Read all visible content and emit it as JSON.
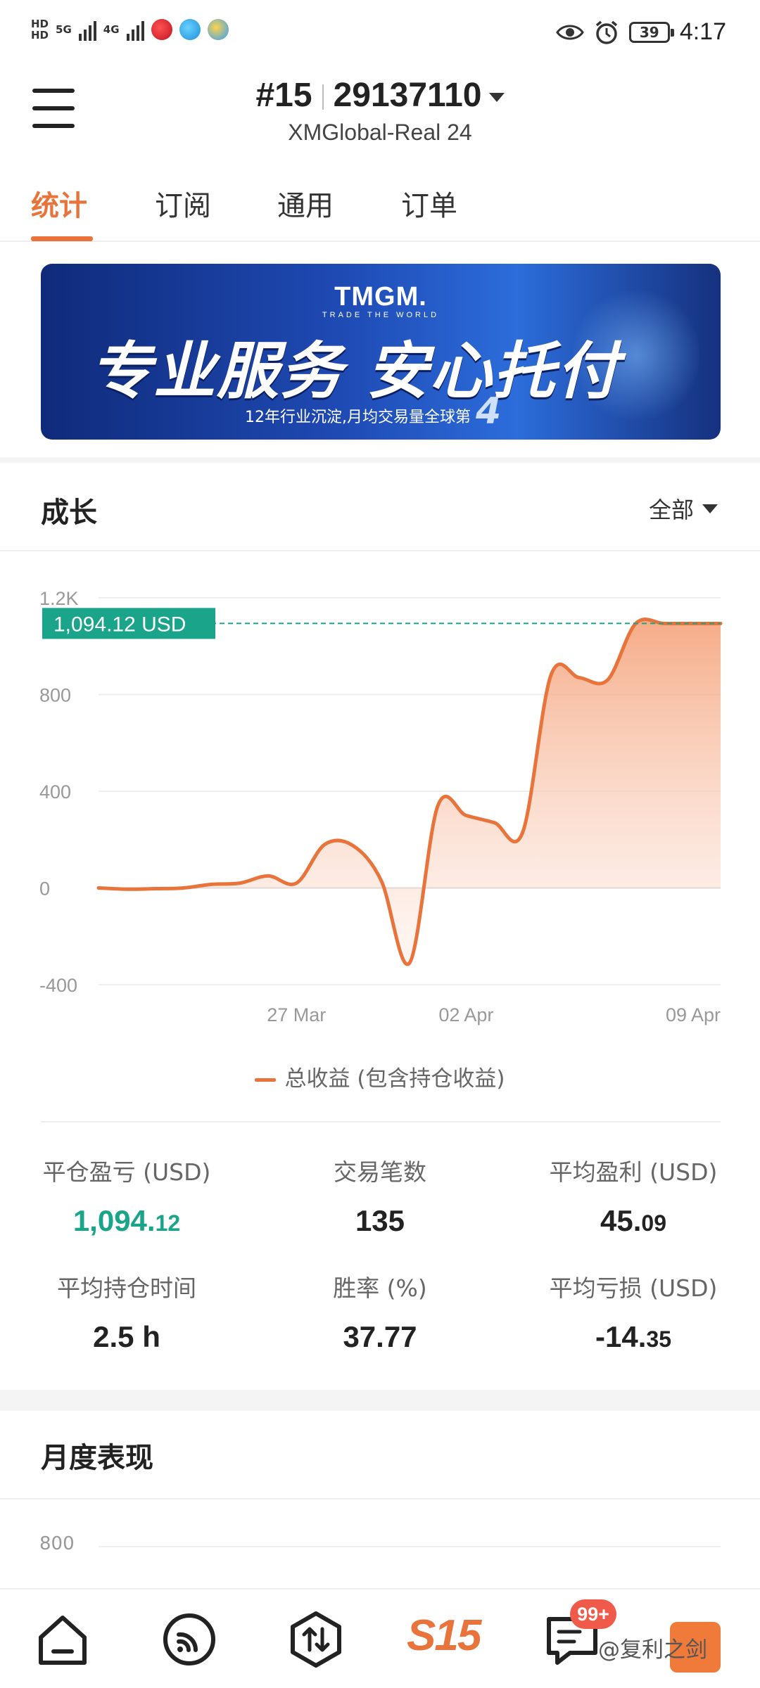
{
  "status_bar": {
    "sim1": "HD",
    "sim2": "HD",
    "net1": "5G",
    "net2": "4G",
    "battery": "39",
    "time": "4:17"
  },
  "header": {
    "rank": "#15",
    "account": "29137110",
    "server": "XMGlobal-Real 24"
  },
  "tabs": [
    "统计",
    "订阅",
    "通用",
    "订单"
  ],
  "banner": {
    "brand": "TMGM.",
    "tagline": "TRADE THE WORLD",
    "headline": "专业服务 安心托付",
    "subline": "12年行业沉淀,月均交易量全球第",
    "rank_number": "4"
  },
  "growth": {
    "title": "成长",
    "range": "全部",
    "current_label": "1,094.12 USD",
    "legend": "总收益 (包含持仓收益)"
  },
  "chart_data": {
    "type": "area",
    "y_ticks": [
      "1.2K",
      "800",
      "400",
      "0",
      "-400"
    ],
    "x_ticks": [
      "27 Mar",
      "02 Apr",
      "09 Apr"
    ],
    "ylim": [
      -400,
      1200
    ],
    "series": [
      {
        "name": "总收益 (包含持仓收益)",
        "color": "#e8743b",
        "x": [
          "03-19",
          "03-20",
          "03-21",
          "03-22",
          "03-23",
          "03-24",
          "03-25",
          "03-26",
          "03-27",
          "03-28",
          "03-29",
          "03-30",
          "03-31",
          "04-01",
          "04-02",
          "04-03",
          "04-04",
          "04-05",
          "04-06",
          "04-07",
          "04-08",
          "04-09",
          "04-10"
        ],
        "values": [
          0,
          -5,
          -3,
          0,
          15,
          20,
          50,
          20,
          180,
          175,
          30,
          -310,
          340,
          300,
          270,
          230,
          880,
          870,
          860,
          1094,
          1094,
          1094,
          1094
        ]
      }
    ],
    "reference_line": 1094.12
  },
  "stats": [
    {
      "label": "平仓盈亏 (USD)",
      "int": "1,094.",
      "dec": "12",
      "color": "green"
    },
    {
      "label": "交易笔数",
      "int": "135",
      "dec": "",
      "color": "default"
    },
    {
      "label": "平均盈利 (USD)",
      "int": "45.",
      "dec": "09",
      "color": "default"
    },
    {
      "label": "平均持仓时间",
      "int": "2.5 h",
      "dec": "",
      "color": "default"
    },
    {
      "label": "胜率 (%)",
      "int": "37.77",
      "dec": "",
      "color": "default"
    },
    {
      "label": "平均亏损 (USD)",
      "int": "-14.",
      "dec": "35",
      "color": "default"
    }
  ],
  "monthly": {
    "title": "月度表现",
    "axis_top": "800"
  },
  "bottom_nav": {
    "items": [
      "home-icon",
      "feed-icon",
      "trade-icon",
      "s15-icon",
      "message-icon",
      "profile-icon"
    ],
    "s15_label": "S15",
    "badge": "99+"
  },
  "watermark": "@复利之剑",
  "colors": {
    "accent": "#e8743b",
    "positive": "#1aa58a",
    "badge": "#f05a4a"
  }
}
